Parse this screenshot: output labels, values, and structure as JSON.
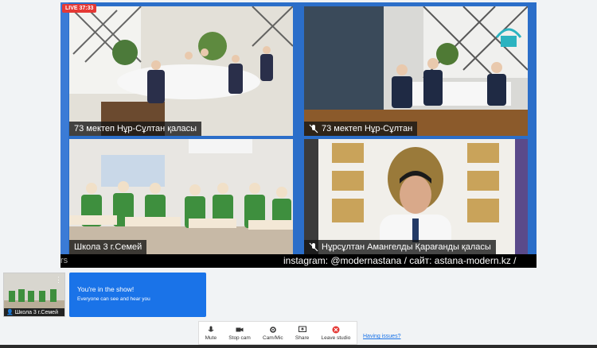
{
  "live_badge": "LIVE 37:33",
  "tiles": [
    {
      "caption": "73 мектеп Нұр-Сұлтан қаласы",
      "muted": false
    },
    {
      "caption": "73 мектеп Нұр-Сұлтан",
      "muted": true
    },
    {
      "caption": "Школа 3 г.Семей",
      "muted": false
    },
    {
      "caption": "Нұрсұлтан Амангелды Қарағанды қаласы",
      "muted": true
    }
  ],
  "ticker": {
    "tail": "rs",
    "text": "instagram: @modernastana / сайт: astana-modern.kz /"
  },
  "selfview": {
    "label": "Школа 3 г.Семей"
  },
  "banner": {
    "title": "You're in the show!",
    "subtitle": "Everyone can see and hear you"
  },
  "toolbar": {
    "mute": "Mute",
    "stop_cam": "Stop cam",
    "cam_mic": "Cam/Mic",
    "share": "Share",
    "leave": "Leave studio"
  },
  "issues_link": "Having issues?",
  "colors": {
    "accent": "#1a73e8",
    "live": "#e53935",
    "stage": "#2b6ec9"
  }
}
